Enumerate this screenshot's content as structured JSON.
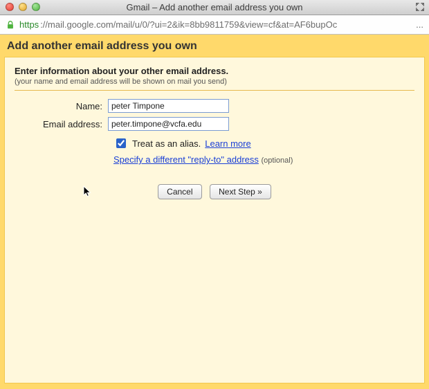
{
  "window": {
    "title": "Gmail – Add another email address you own"
  },
  "address_bar": {
    "scheme": "https",
    "rest": "://mail.google.com/mail/u/0/?ui=2&ik=8bb9811759&view=cf&at=AF6bupOc"
  },
  "page": {
    "header": "Add another email address you own",
    "section_title": "Enter information about your other email address.",
    "section_sub": "(your name and email address will be shown on mail you send)",
    "name_label": "Name:",
    "email_label": "Email address:",
    "name_value": "peter Timpone",
    "email_value": "peter.timpone@vcfa.edu",
    "alias_checked": true,
    "alias_label": "Treat as an alias.",
    "learn_more": "Learn more",
    "replyto_link": "Specify a different \"reply-to\" address",
    "optional": "(optional)",
    "cancel": "Cancel",
    "next": "Next Step »"
  }
}
